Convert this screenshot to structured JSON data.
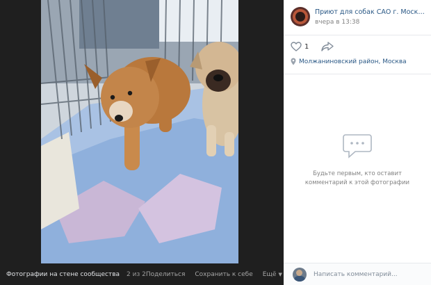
{
  "colors": {
    "viewer_bg": "#1f1f1f",
    "link": "#2a5885",
    "muted_text": "#828282",
    "divider": "#e7e8ec"
  },
  "photo": {
    "subject": "two puppies on a blanket inside a metal pen"
  },
  "viewer_bar": {
    "title": "Фотографии на стене сообщества",
    "counter": "2 из 2",
    "share_label": "Поделиться",
    "save_label": "Сохранить к себе",
    "more_label": "Ещё"
  },
  "post": {
    "author": "Приют для собак САО г. Москвы в …",
    "time": "вчера в 13:38",
    "likes": "1",
    "location": "Молжаниновский район, Москва"
  },
  "comments": {
    "empty_text": "Будьте первым, кто оставит комментарий к этой фотографии",
    "placeholder": "Написать комментарий..."
  },
  "icons": {
    "like": "heart-icon",
    "share": "share-arrow-icon",
    "location": "location-pin-icon",
    "empty": "comment-bubble-icon"
  }
}
